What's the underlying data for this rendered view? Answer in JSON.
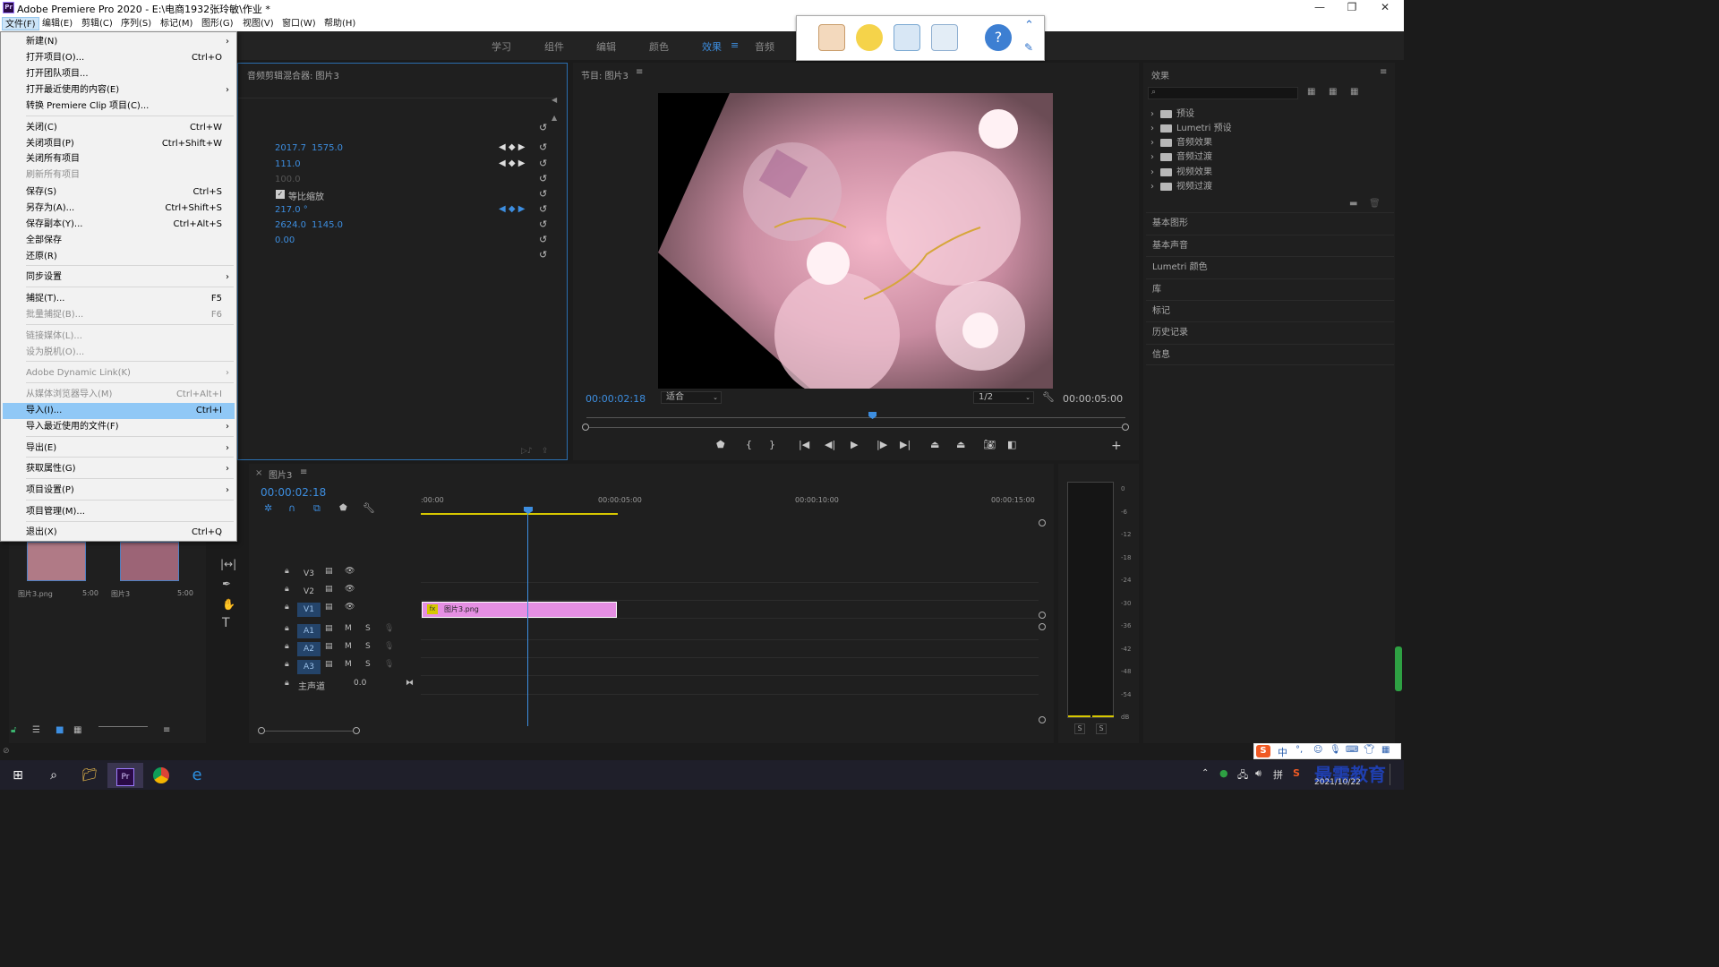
{
  "window": {
    "title": "Adobe Premiere Pro 2020 - E:\\电商1932张玲敏\\作业 *",
    "logo": "Pr"
  },
  "menubar": {
    "items": [
      "文件(F)",
      "编辑(E)",
      "剪辑(C)",
      "序列(S)",
      "标记(M)",
      "图形(G)",
      "视图(V)",
      "窗口(W)",
      "帮助(H)"
    ]
  },
  "workspaces": {
    "items": [
      "学习",
      "组件",
      "编辑",
      "颜色",
      "效果",
      "音频"
    ],
    "active": "效果"
  },
  "file_menu": {
    "items": [
      {
        "label": "新建(N)",
        "shortcut": "",
        "arrow": "›",
        "disabled": false
      },
      {
        "label": "打开项目(O)...",
        "shortcut": "Ctrl+O",
        "arrow": "",
        "disabled": false
      },
      {
        "label": "打开团队项目...",
        "shortcut": "",
        "arrow": "",
        "disabled": false
      },
      {
        "label": "打开最近使用的内容(E)",
        "shortcut": "",
        "arrow": "›",
        "disabled": false
      },
      {
        "label": "转换 Premiere Clip 项目(C)...",
        "shortcut": "",
        "arrow": "",
        "disabled": false
      },
      {
        "label": "关闭(C)",
        "shortcut": "Ctrl+W",
        "arrow": "",
        "disabled": false
      },
      {
        "label": "关闭项目(P)",
        "shortcut": "Ctrl+Shift+W",
        "arrow": "",
        "disabled": false
      },
      {
        "label": "关闭所有项目",
        "shortcut": "",
        "arrow": "",
        "disabled": false
      },
      {
        "label": "刷新所有项目",
        "shortcut": "",
        "arrow": "",
        "disabled": true
      },
      {
        "label": "保存(S)",
        "shortcut": "Ctrl+S",
        "arrow": "",
        "disabled": false
      },
      {
        "label": "另存为(A)...",
        "shortcut": "Ctrl+Shift+S",
        "arrow": "",
        "disabled": false
      },
      {
        "label": "保存副本(Y)...",
        "shortcut": "Ctrl+Alt+S",
        "arrow": "",
        "disabled": false
      },
      {
        "label": "全部保存",
        "shortcut": "",
        "arrow": "",
        "disabled": false
      },
      {
        "label": "还原(R)",
        "shortcut": "",
        "arrow": "",
        "disabled": false
      },
      {
        "label": "同步设置",
        "shortcut": "",
        "arrow": "›",
        "disabled": false
      },
      {
        "label": "捕捉(T)...",
        "shortcut": "F5",
        "arrow": "",
        "disabled": false
      },
      {
        "label": "批量捕捉(B)...",
        "shortcut": "F6",
        "arrow": "",
        "disabled": true
      },
      {
        "label": "链接媒体(L)...",
        "shortcut": "",
        "arrow": "",
        "disabled": true
      },
      {
        "label": "设为脱机(O)...",
        "shortcut": "",
        "arrow": "",
        "disabled": true
      },
      {
        "label": "Adobe Dynamic Link(K)",
        "shortcut": "",
        "arrow": "›",
        "disabled": true
      },
      {
        "label": "从媒体浏览器导入(M)",
        "shortcut": "Ctrl+Alt+I",
        "arrow": "",
        "disabled": true
      },
      {
        "label": "导入(I)...",
        "shortcut": "Ctrl+I",
        "arrow": "",
        "disabled": false,
        "selected": true
      },
      {
        "label": "导入最近使用的文件(F)",
        "shortcut": "",
        "arrow": "›",
        "disabled": false
      },
      {
        "label": "导出(E)",
        "shortcut": "",
        "arrow": "›",
        "disabled": false
      },
      {
        "label": "获取属性(G)",
        "shortcut": "",
        "arrow": "›",
        "disabled": false
      },
      {
        "label": "项目设置(P)",
        "shortcut": "",
        "arrow": "›",
        "disabled": false
      },
      {
        "label": "项目管理(M)...",
        "shortcut": "",
        "arrow": "",
        "disabled": false
      },
      {
        "label": "退出(X)",
        "shortcut": "Ctrl+Q",
        "arrow": "",
        "disabled": false
      }
    ]
  },
  "effect_controls": {
    "tab": "音频剪辑混合器: 图片3",
    "position": [
      "2017.7",
      "1575.0"
    ],
    "scale": "111.0",
    "scale_width": "100.0",
    "uniform_scale": "等比缩放",
    "rotation": "217.0 °",
    "anchor": [
      "2624.0",
      "1145.0"
    ],
    "antiflicker": "0.00"
  },
  "program_monitor": {
    "title": "节目: 图片3",
    "timecode": "00:00:02:18",
    "fit": "适合",
    "resolution": "1/2",
    "duration": "00:00:05:00",
    "playhead_fraction": 0.53
  },
  "project": {
    "items": [
      {
        "name": "图片3.png",
        "duration": "5:00"
      },
      {
        "name": "图片3",
        "duration": "5:00"
      }
    ]
  },
  "timeline": {
    "tab": "图片3",
    "timecode": "00:00:02:18",
    "ruler": [
      ":00:00",
      "00:00:05:00",
      "00:00:10:00",
      "00:00:15:00"
    ],
    "video_tracks": [
      "V3",
      "V2",
      "V1"
    ],
    "audio_tracks": [
      "A1",
      "A2",
      "A3"
    ],
    "master": {
      "label": "主声道",
      "value": "0.0"
    },
    "clip": {
      "name": "图片3.png",
      "badge": "fx",
      "track": "V1"
    },
    "mute_label": "M",
    "solo_label": "S"
  },
  "audio_meter": {
    "ticks": [
      "0",
      "-6",
      "-12",
      "-18",
      "-24",
      "-30",
      "-36",
      "-42",
      "-48",
      "-54",
      "dB"
    ],
    "buttons": [
      "S",
      "S"
    ]
  },
  "effects_panel": {
    "title": "效果",
    "folders": [
      "预设",
      "Lumetri 预设",
      "音频效果",
      "音频过渡",
      "视频效果",
      "视频过渡"
    ],
    "sections": [
      "基本图形",
      "基本声音",
      "Lumetri 颜色",
      "库",
      "标记",
      "历史记录",
      "信息"
    ]
  },
  "taskbar": {
    "date": "2021/10/22",
    "watermark": "最需教育",
    "ime": "中"
  },
  "colors": {
    "accent": "#3d8ee0",
    "clip": "#e58fe3",
    "menu_selected": "#90c8f6",
    "work_area": "#d6c700"
  }
}
